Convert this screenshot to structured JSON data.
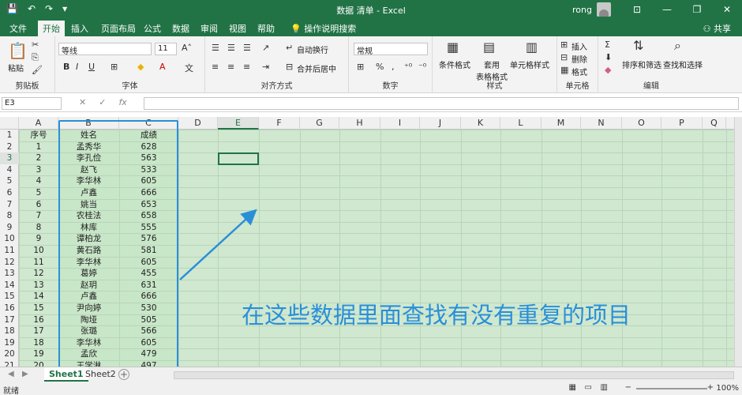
{
  "window": {
    "title": "数据 清单 - Excel",
    "user": "rong",
    "min": "—",
    "restore": "❐",
    "close": "✕"
  },
  "tabs": [
    "文件",
    "开始",
    "插入",
    "页面布局",
    "公式",
    "数据",
    "审阅",
    "视图",
    "帮助"
  ],
  "active_tab": "开始",
  "tell_me": "操作说明搜索",
  "share": "共享",
  "ribbon": {
    "clipboard": {
      "label": "剪贴板",
      "paste": "粘贴"
    },
    "font": {
      "label": "字体",
      "name": "等线",
      "size": "11",
      "bold": "B",
      "italic": "I",
      "underline": "U"
    },
    "alignment": {
      "label": "对齐方式",
      "wrap": "自动换行",
      "merge": "合并后居中"
    },
    "number": {
      "label": "数字",
      "format": "常规",
      "percent": "%"
    },
    "styles": {
      "label": "样式",
      "conditional": "条件格式",
      "table": "套用\n表格格式",
      "cell": "单元格样式"
    },
    "cells": {
      "label": "单元格",
      "insert": "插入",
      "delete": "删除",
      "format": "格式"
    },
    "editing": {
      "label": "编辑",
      "sort": "排序和筛选",
      "find": "查找和选择"
    }
  },
  "formula_bar": {
    "name_box": "E3",
    "fx": "fx",
    "cancel": "✕",
    "confirm": "✓"
  },
  "columns": [
    "A",
    "B",
    "C",
    "D",
    "E",
    "F",
    "G",
    "H",
    "I",
    "J",
    "K",
    "L",
    "M",
    "N",
    "O",
    "P",
    "Q"
  ],
  "row_numbers": [
    "1",
    "2",
    "3",
    "4",
    "5",
    "6",
    "7",
    "8",
    "9",
    "10",
    "11",
    "12",
    "13",
    "14",
    "15",
    "16",
    "17",
    "18",
    "19",
    "20",
    "21"
  ],
  "table": {
    "header": [
      "序号",
      "姓名",
      "成绩"
    ],
    "rows": [
      [
        "1",
        "孟秀华",
        "628"
      ],
      [
        "2",
        "李孔俭",
        "563"
      ],
      [
        "3",
        "赵飞",
        "533"
      ],
      [
        "4",
        "李华林",
        "605"
      ],
      [
        "5",
        "卢鑫",
        "666"
      ],
      [
        "6",
        "姚当",
        "653"
      ],
      [
        "7",
        "农桂法",
        "658"
      ],
      [
        "8",
        "林库",
        "555"
      ],
      [
        "9",
        "谭柏龙",
        "576"
      ],
      [
        "10",
        "黄石路",
        "581"
      ],
      [
        "11",
        "李华林",
        "605"
      ],
      [
        "12",
        "葛婷",
        "455"
      ],
      [
        "13",
        "赵玥",
        "631"
      ],
      [
        "14",
        "卢鑫",
        "666"
      ],
      [
        "15",
        "尹向婷",
        "530"
      ],
      [
        "16",
        "陶垭",
        "505"
      ],
      [
        "17",
        "张璐",
        "566"
      ],
      [
        "18",
        "李华林",
        "605"
      ],
      [
        "19",
        "孟欣",
        "479"
      ],
      [
        "20",
        "王学淋",
        "497"
      ]
    ]
  },
  "annotation": "在这些数据里面查找有没有重复的项目",
  "sheets": [
    "Sheet1",
    "Sheet2"
  ],
  "active_sheet": "Sheet1",
  "status": {
    "ready": "就绪",
    "zoom": "100%"
  },
  "colors": {
    "excel_green": "#217346",
    "highlight_blue": "#2a8fd8",
    "cell_bg": "#cfe8cf"
  }
}
